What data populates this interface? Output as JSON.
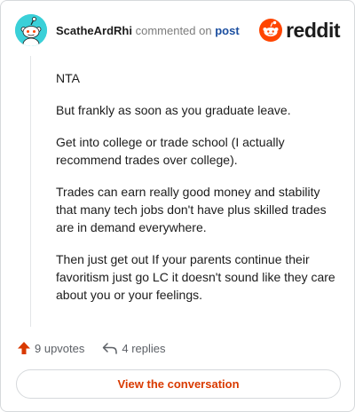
{
  "comment": {
    "username": "ScatheArdRhi",
    "action_text": "commented on",
    "post_link": "post",
    "paragraphs": [
      "NTA",
      "But frankly as soon as you graduate leave.",
      "Get into college or trade school (I actually recommend trades over college).",
      "Trades can earn really good money and stability that many tech jobs don't have plus skilled trades are in demand everywhere.",
      "Then just get out If your parents continue their favoritism just go LC it doesn't sound like they care about you or your feelings."
    ]
  },
  "brand": {
    "logo_text": "reddit",
    "color": "#ff4500"
  },
  "actions": {
    "upvotes": "9 upvotes",
    "replies": "4 replies",
    "upvote_color": "#d93a00"
  },
  "view_button": {
    "label": "View the conversation"
  },
  "icons": [
    "snoo-avatar-icon",
    "reddit-logo-icon",
    "upvote-arrow-icon",
    "reply-arrow-icon"
  ]
}
